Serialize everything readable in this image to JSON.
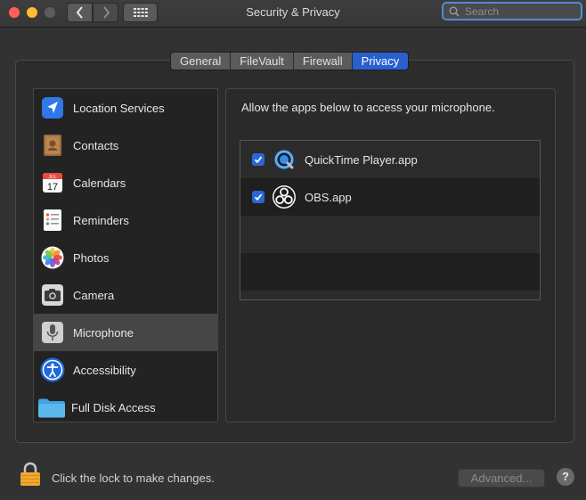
{
  "window": {
    "title": "Security & Privacy",
    "search_placeholder": "Search"
  },
  "tabs": [
    {
      "label": "General",
      "active": false
    },
    {
      "label": "FileVault",
      "active": false
    },
    {
      "label": "Firewall",
      "active": false
    },
    {
      "label": "Privacy",
      "active": true
    }
  ],
  "sidebar": {
    "items": [
      {
        "label": "Location Services",
        "icon": "location-arrow-icon"
      },
      {
        "label": "Contacts",
        "icon": "contacts-book-icon"
      },
      {
        "label": "Calendars",
        "icon": "calendar-icon",
        "calendar_month": "JUL",
        "calendar_day": "17"
      },
      {
        "label": "Reminders",
        "icon": "reminders-list-icon"
      },
      {
        "label": "Photos",
        "icon": "photos-flower-icon"
      },
      {
        "label": "Camera",
        "icon": "camera-icon"
      },
      {
        "label": "Microphone",
        "icon": "microphone-icon",
        "selected": true
      },
      {
        "label": "Accessibility",
        "icon": "accessibility-icon"
      },
      {
        "label": "Full Disk Access",
        "icon": "folder-icon"
      }
    ]
  },
  "privacy_panel": {
    "prompt": "Allow the apps below to access your microphone.",
    "apps": [
      {
        "name": "QuickTime Player.app",
        "checked": true,
        "icon": "quicktime-icon"
      },
      {
        "name": "OBS.app",
        "checked": true,
        "icon": "obs-icon"
      }
    ]
  },
  "footer": {
    "lock_text": "Click the lock to make changes.",
    "advanced_label": "Advanced...",
    "help_label": "?"
  },
  "colors": {
    "accent": "#2a5fd0",
    "window_bg": "#323232",
    "checkbox": "#2a67d8",
    "lock": "#f0a830"
  }
}
